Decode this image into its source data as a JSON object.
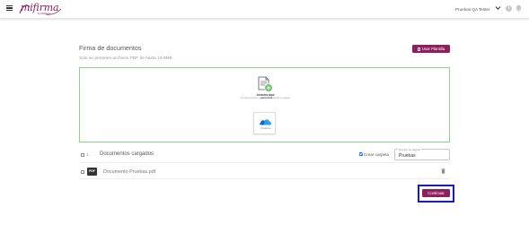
{
  "header": {
    "logo_text": "mifirma",
    "logo_tagline": "by Multinivel",
    "user_name": "Pruebas QA Tester",
    "info_glyph": "i",
    "icons": [
      "menu-icon",
      "chevron-down-icon",
      "info-icon",
      "bell-icon"
    ]
  },
  "page": {
    "title": "Firma de documentos",
    "subtitle": "Solo se permiten archivos PDF de hasta 19.9MB",
    "template_button": "Usar Plantilla"
  },
  "dropzone": {
    "title": "Arrastra aquí",
    "hint_prefix": "tus documentos o",
    "hint_link": "selecciona",
    "hint_suffix": "desde tu equipo",
    "cloud_label": "OneDrive"
  },
  "documents": {
    "header_label": "Documentos cargados",
    "count": "1",
    "create_folder_label": "Crear carpeta",
    "create_folder_checked": true,
    "folder_field_legend": "Nombre de carpeta",
    "folder_name": "Pruebas",
    "files": [
      {
        "type_badge": "PDF",
        "name": "Documento Pruebas.pdf"
      }
    ]
  },
  "actions": {
    "continue_button": "Continuar"
  },
  "colors": {
    "brand": "#8e1f5e",
    "dropzone_border": "#8fd08b",
    "highlight_outline": "#1a1ab8"
  }
}
